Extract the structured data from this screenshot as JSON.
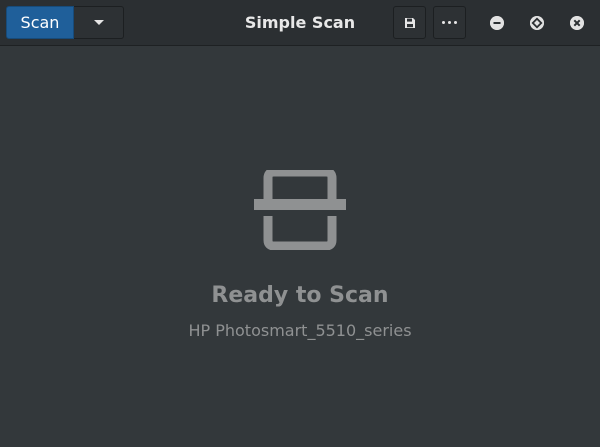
{
  "window": {
    "title": "Simple Scan"
  },
  "toolbar": {
    "scan_label": "Scan",
    "dropdown_icon": "chevron-down-icon",
    "save_icon": "floppy-disk-icon",
    "menu_icon": "more-horizontal-icon",
    "accent_color": "#1f5f9a"
  },
  "window_controls": {
    "minimize_icon": "minimize-icon",
    "maximize_icon": "maximize-icon",
    "close_icon": "close-icon"
  },
  "status": {
    "icon": "scanner-icon",
    "title": "Ready to Scan",
    "device": "HP Photosmart_5510_series"
  }
}
